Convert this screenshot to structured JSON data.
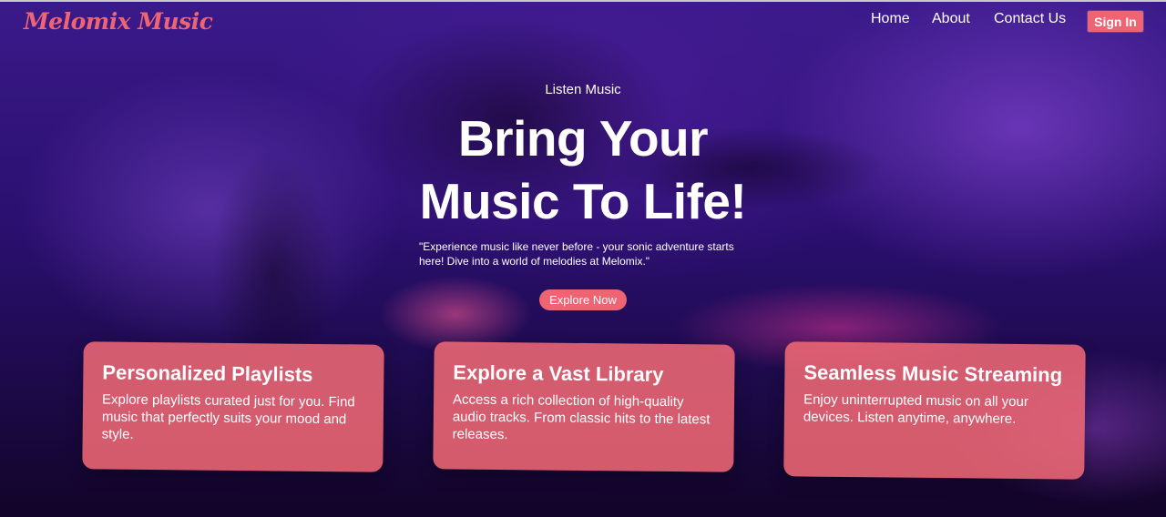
{
  "header": {
    "logo": "Melomix Music",
    "nav": [
      {
        "label": "Home"
      },
      {
        "label": "About"
      },
      {
        "label": "Contact Us"
      }
    ],
    "signin_label": "Sign In"
  },
  "hero": {
    "eyebrow": "Listen Music",
    "headline_line1": "Bring Your",
    "headline_line2": "Music To Life!",
    "tagline": "\"Experience music like never before - your sonic adventure starts here! Dive into a world of melodies at Melomix.\"",
    "cta_label": "Explore Now"
  },
  "cards": [
    {
      "title": "Personalized Playlists",
      "text": "Explore playlists curated just for you. Find music that perfectly suits your mood and style."
    },
    {
      "title": "Explore a Vast Library",
      "text": "Access a rich collection of high-quality audio tracks. From classic hits to the latest releases."
    },
    {
      "title": "Seamless Music Streaming",
      "text": "Enjoy uninterrupted music on all your devices. Listen anytime, anywhere."
    }
  ],
  "colors": {
    "accent": "#ef6473",
    "background": "#2a0f6e"
  }
}
